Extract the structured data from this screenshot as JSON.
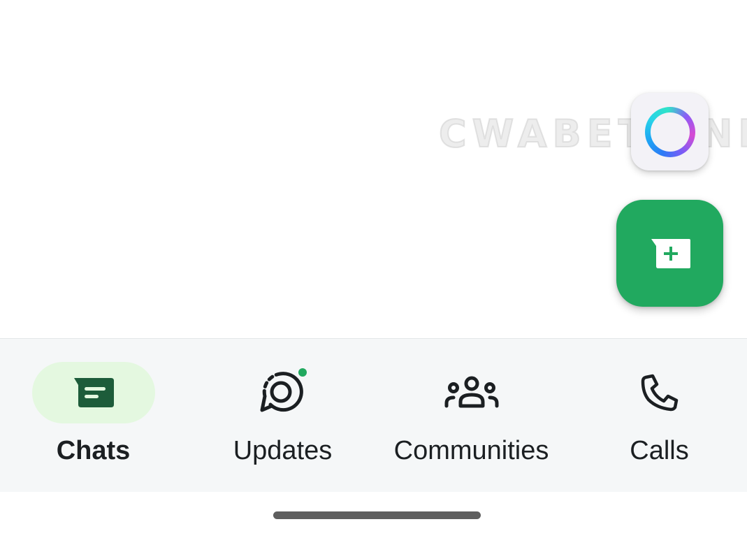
{
  "watermark": {
    "text": "CWABETAINFO"
  },
  "colors": {
    "accent_green": "#21a95f",
    "active_pill": "#e4f8e0",
    "active_icon": "#1d5c3a",
    "nav_background": "#f5f7f8",
    "notification_dot": "#21a95f"
  },
  "fabs": {
    "meta_ai": {
      "icon": "meta-ai-ring-icon"
    },
    "new_chat": {
      "icon": "new-chat-icon"
    }
  },
  "bottom_nav": {
    "items": [
      {
        "label": "Chats",
        "icon": "chats-icon",
        "active": true
      },
      {
        "label": "Updates",
        "icon": "updates-icon",
        "active": false,
        "has_notification_dot": true
      },
      {
        "label": "Communities",
        "icon": "communities-icon",
        "active": false
      },
      {
        "label": "Calls",
        "icon": "calls-icon",
        "active": false
      }
    ]
  }
}
